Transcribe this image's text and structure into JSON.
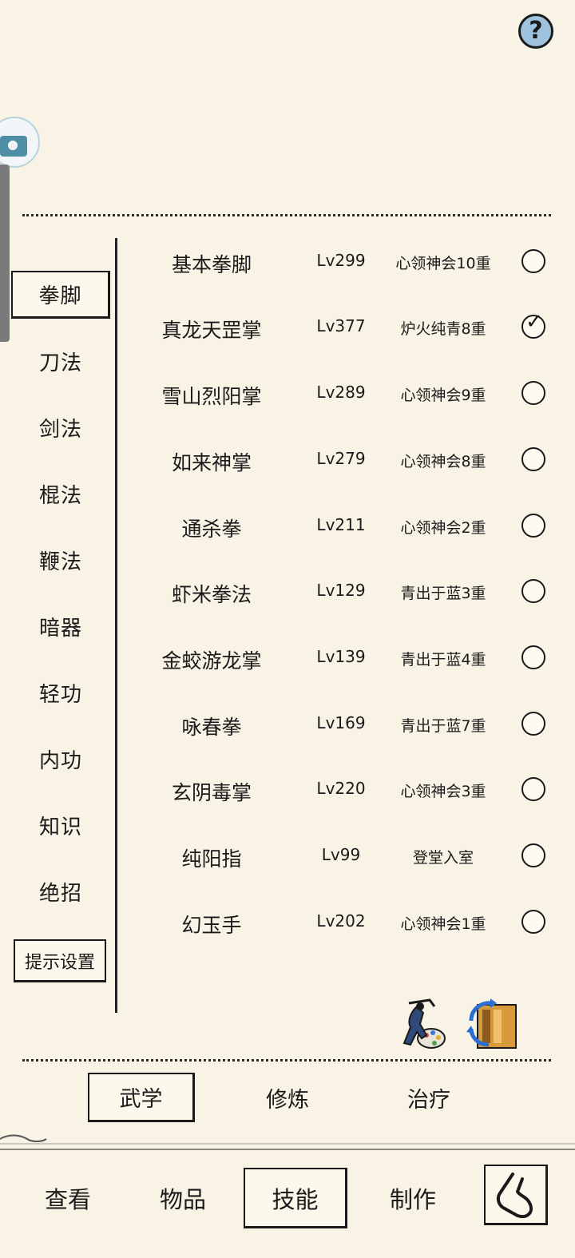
{
  "help": {
    "symbol": "?"
  },
  "categories": [
    "拳脚",
    "刀法",
    "剑法",
    "棍法",
    "鞭法",
    "暗器",
    "轻功",
    "内功",
    "知识",
    "绝招"
  ],
  "selected_category": "拳脚",
  "hint_settings_label": "提示设置",
  "skills": [
    {
      "name": "基本拳脚",
      "level": "Lv299",
      "stage": "心领神会10重",
      "checked": false
    },
    {
      "name": "真龙天罡掌",
      "level": "Lv377",
      "stage": "炉火纯青8重",
      "checked": true
    },
    {
      "name": "雪山烈阳掌",
      "level": "Lv289",
      "stage": "心领神会9重",
      "checked": false
    },
    {
      "name": "如来神掌",
      "level": "Lv279",
      "stage": "心领神会8重",
      "checked": false
    },
    {
      "name": "通杀拳",
      "level": "Lv211",
      "stage": "心领神会2重",
      "checked": false
    },
    {
      "name": "虾米拳法",
      "level": "Lv129",
      "stage": "青出于蓝3重",
      "checked": false
    },
    {
      "name": "金蛟游龙掌",
      "level": "Lv139",
      "stage": "青出于蓝4重",
      "checked": false
    },
    {
      "name": "咏春拳",
      "level": "Lv169",
      "stage": "青出于蓝7重",
      "checked": false
    },
    {
      "name": "玄阴毒掌",
      "level": "Lv220",
      "stage": "心领神会3重",
      "checked": false
    },
    {
      "name": "纯阳指",
      "level": "Lv99",
      "stage": "登堂入室",
      "checked": false
    },
    {
      "name": "幻玉手",
      "level": "Lv202",
      "stage": "心领神会1重",
      "checked": false
    }
  ],
  "subtabs": [
    "武学",
    "修炼",
    "治疗"
  ],
  "selected_subtab": "武学",
  "nav": [
    "查看",
    "物品",
    "技能",
    "制作"
  ],
  "selected_nav": "技能",
  "icons": {
    "martial_customize": "fighter-palette-icon",
    "swap": "book-swap-icon",
    "back": "back-arrow-icon",
    "float": "floating-assist-icon"
  }
}
